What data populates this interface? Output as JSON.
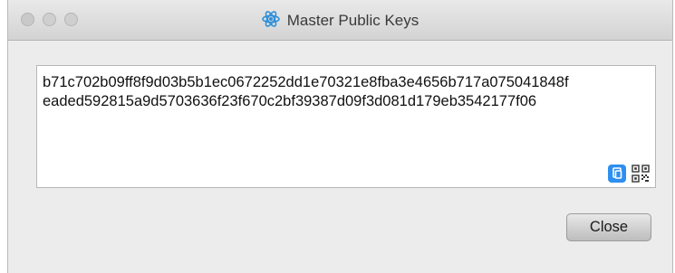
{
  "window": {
    "title": "Master Public Keys",
    "icon": "atom-logo-icon"
  },
  "traffic_lights": [
    "close-dot",
    "minimize-dot",
    "maximize-dot"
  ],
  "key_field": {
    "line1": "b71c702b09ff8f9d03b5b1ec0672252dd1e70321e8fba3e4656b717a075041848f",
    "line2": "eaded592815a9d5703636f23f670c2bf39387d09f3d081d179eb3542177f06"
  },
  "icons": {
    "copy": "copy-icon",
    "qr": "qr-code-icon"
  },
  "buttons": {
    "close_label": "Close"
  }
}
